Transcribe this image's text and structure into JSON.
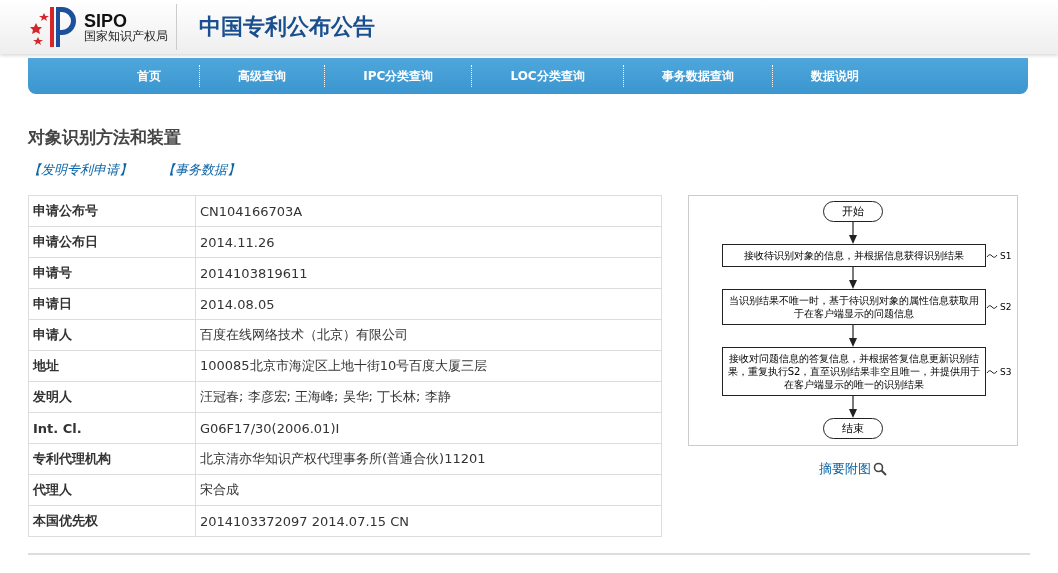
{
  "header": {
    "logo_text": "SIPO",
    "logo_subtitle": "国家知识产权局",
    "site_title": "中国专利公布公告"
  },
  "nav": [
    {
      "label": "首页"
    },
    {
      "label": "高级查询"
    },
    {
      "label": "IPC分类查询"
    },
    {
      "label": "LOC分类查询"
    },
    {
      "label": "事务数据查询"
    },
    {
      "label": "数据说明"
    }
  ],
  "title": "对象识别方法和装置",
  "links": [
    {
      "label": "【发明专利申请】"
    },
    {
      "label": "【事务数据】"
    }
  ],
  "table": {
    "rows": [
      {
        "label": "申请公布号",
        "value": "CN104166703A"
      },
      {
        "label": "申请公布日",
        "value": "2014.11.26"
      },
      {
        "label": "申请号",
        "value": "2014103819611"
      },
      {
        "label": "申请日",
        "value": "2014.08.05"
      },
      {
        "label": "申请人",
        "value": "百度在线网络技术（北京）有限公司"
      },
      {
        "label": "地址",
        "value": "100085北京市海淀区上地十街10号百度大厦三层"
      },
      {
        "label": "发明人",
        "value": "汪冠春; 李彦宏; 王海峰; 吴华; 丁长林; 李静"
      },
      {
        "label": "Int. Cl.",
        "value": "G06F17/30(2006.01)I"
      },
      {
        "label": "专利代理机构",
        "value": "北京清亦华知识产权代理事务所(普通合伙)11201"
      },
      {
        "label": "代理人",
        "value": "宋合成"
      },
      {
        "label": "本国优先权",
        "value": "2014103372097 2014.07.15 CN"
      }
    ]
  },
  "figure": {
    "start": "开始",
    "end": "结束",
    "steps": [
      {
        "text": "接收待识别对象的信息，并根据信息获得识别结果",
        "tag": "S1"
      },
      {
        "text": "当识别结果不唯一时，基于待识别对象的属性信息获取用于在客户端显示的问题信息",
        "tag": "S2"
      },
      {
        "text": "接收对问题信息的答复信息，并根据答复信息更新识别结果，重复执行S2，直至识别结果非空且唯一，并提供用于在客户端显示的唯一的识别结果",
        "tag": "S3"
      }
    ],
    "caption": "摘要附图"
  }
}
